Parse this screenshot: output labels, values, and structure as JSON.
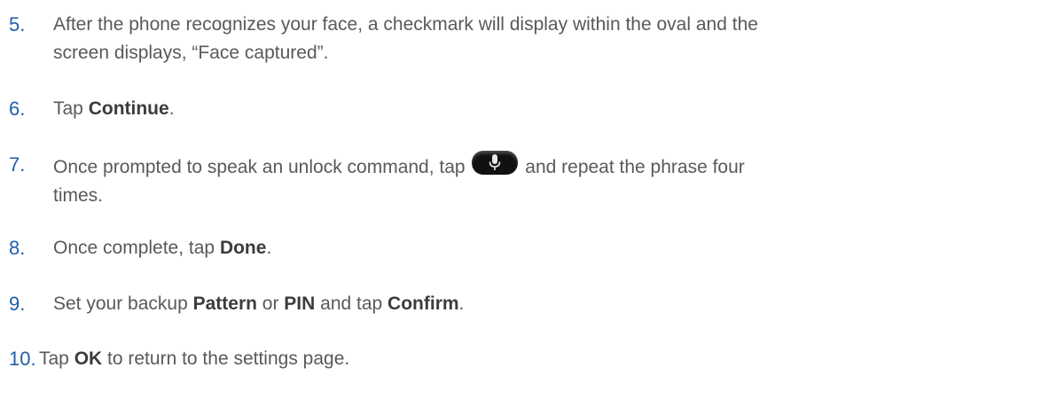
{
  "steps": [
    {
      "number": "5.",
      "line1": "After the phone recognizes your face, a checkmark will display within the oval and the",
      "line2": "screen displays, “Face captured”."
    },
    {
      "number": "6.",
      "pre": "Tap ",
      "bold": "Continue",
      "post": "."
    },
    {
      "number": "7.",
      "pre": "Once prompted to speak an unlock command, tap ",
      "icon": "microphone-button-icon",
      "post": " and repeat the phrase four",
      "line2": "times."
    },
    {
      "number": "8.",
      "pre": "Once complete, tap ",
      "bold": "Done",
      "post": "."
    },
    {
      "number": "9.",
      "pre": "Set your backup ",
      "bold1": "Pattern",
      "mid1": " or ",
      "bold2": "PIN",
      "mid2": " and tap ",
      "bold3": "Confirm",
      "post": "."
    },
    {
      "number": "10.",
      "pre": "Tap ",
      "bold": "OK",
      "post": " to return to the settings page."
    }
  ],
  "colors": {
    "number": "#1f5fa8",
    "text": "#595959",
    "bold": "#3c3c3c"
  }
}
